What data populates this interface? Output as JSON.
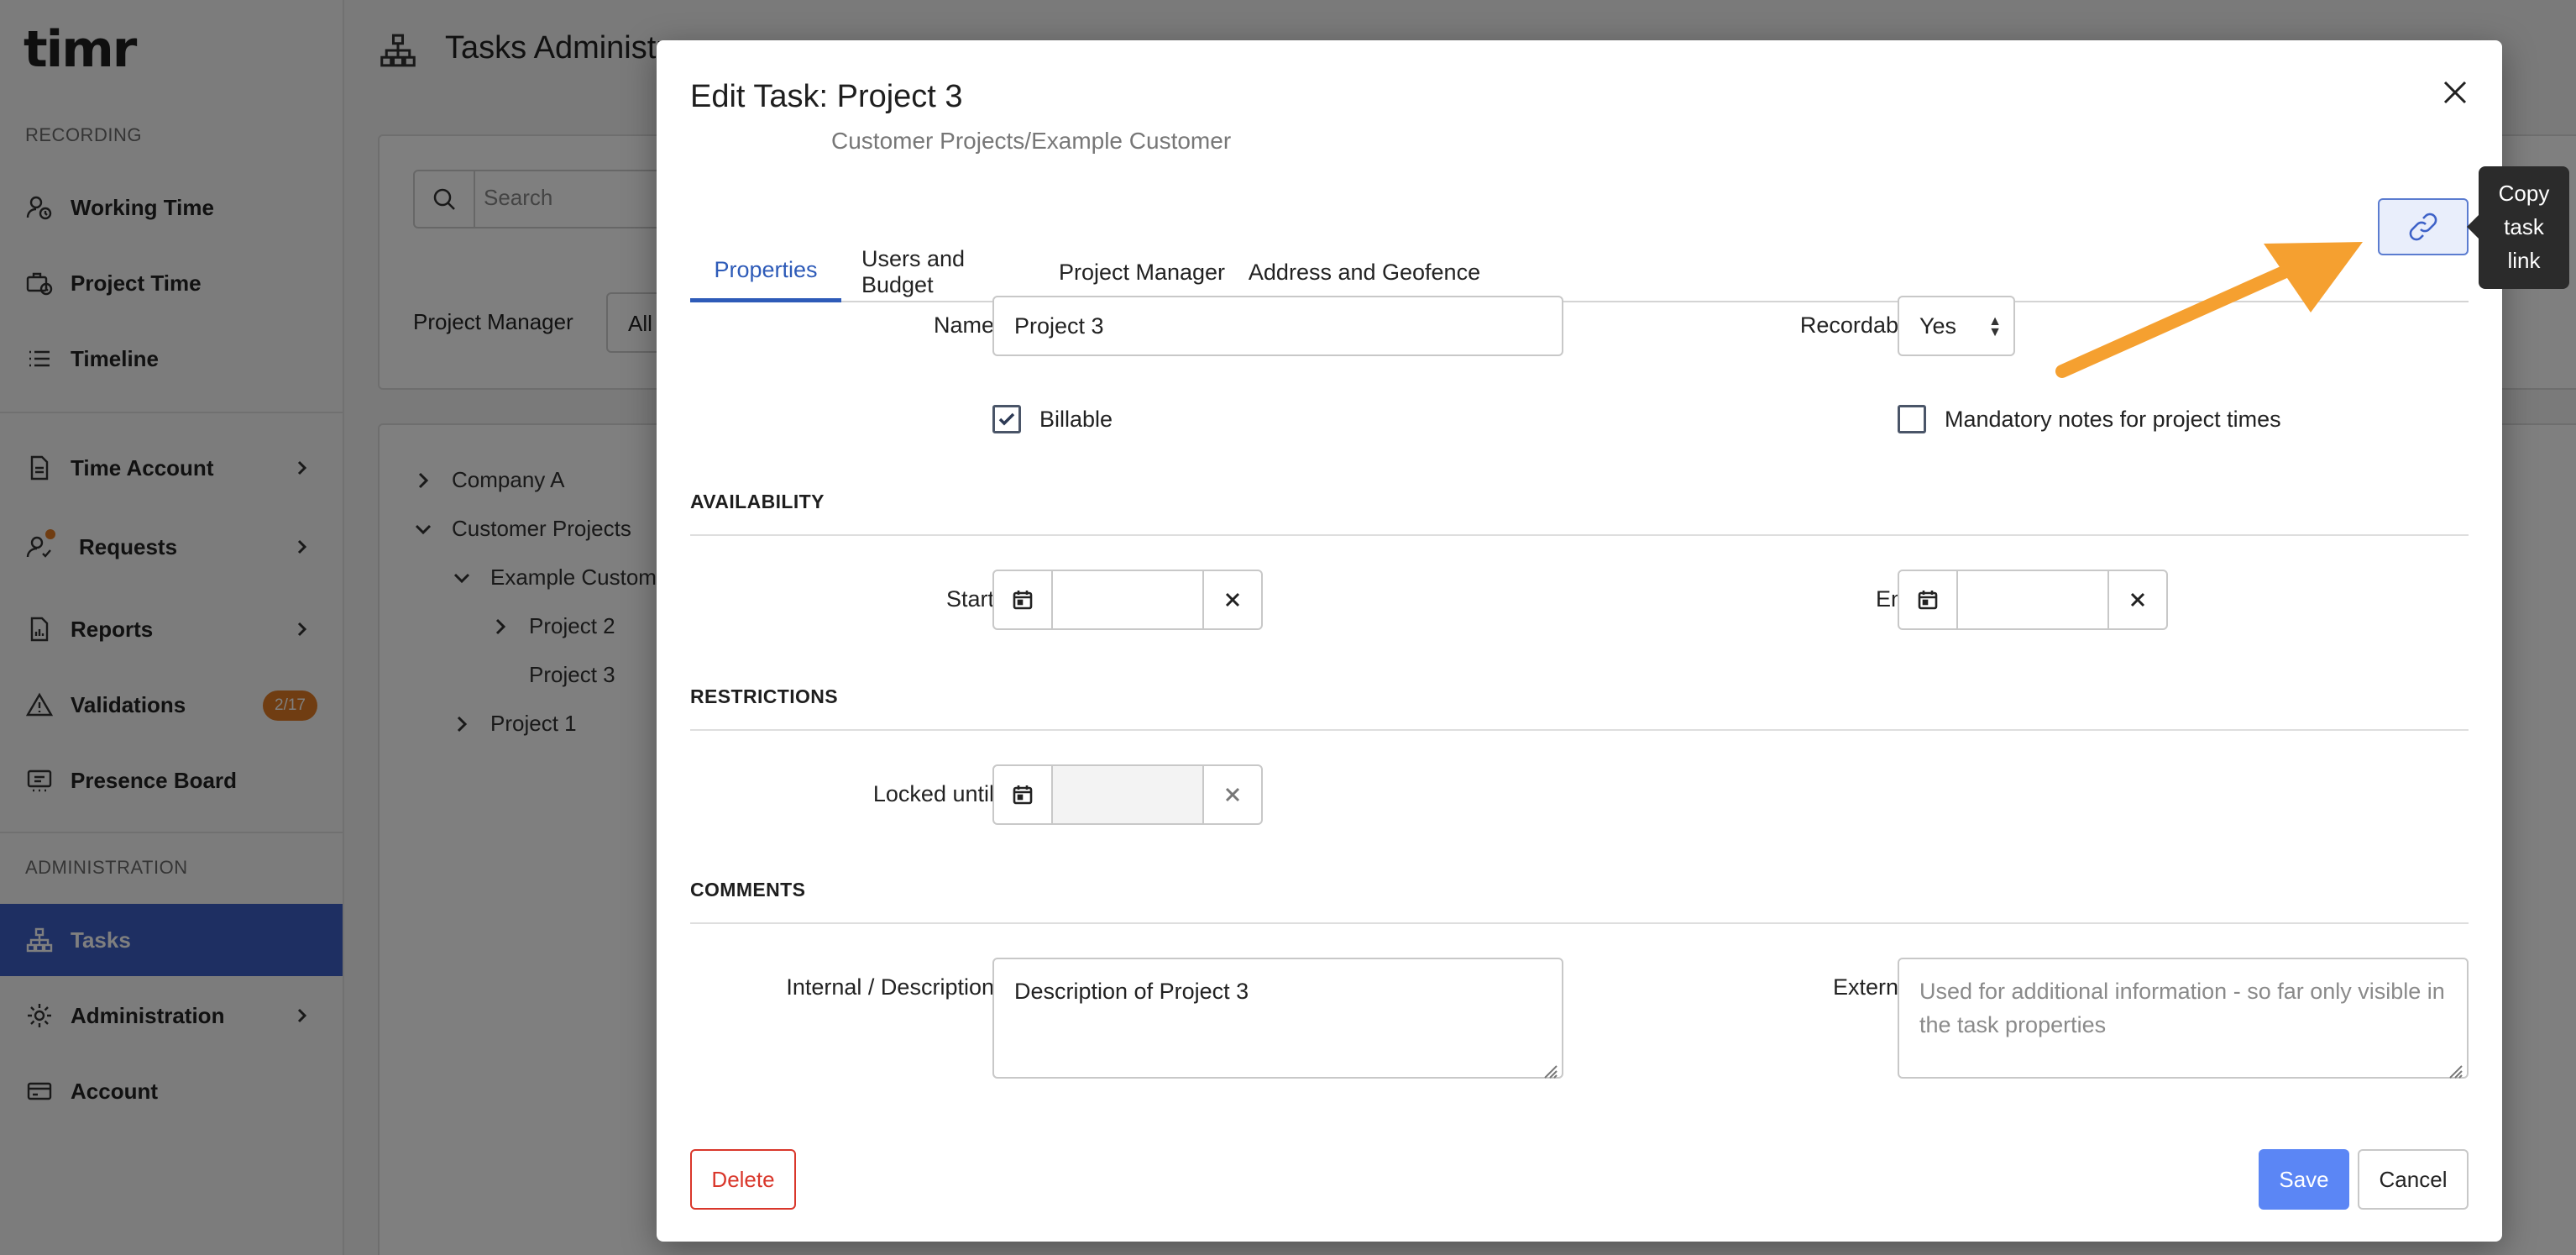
{
  "app": {
    "logo": "timr"
  },
  "sidebar": {
    "section_recording": "RECORDING",
    "section_administration": "ADMINISTRATION",
    "items": [
      {
        "label": "Working Time",
        "icon": "user-clock-icon"
      },
      {
        "label": "Project Time",
        "icon": "briefcase-clock-icon"
      },
      {
        "label": "Timeline",
        "icon": "list-icon"
      },
      {
        "label": "Time Account",
        "icon": "document-icon",
        "has_submenu": true
      },
      {
        "label": "Requests",
        "icon": "user-request-icon",
        "has_submenu": true,
        "notification_dot": true
      },
      {
        "label": "Reports",
        "icon": "report-icon",
        "has_submenu": true
      },
      {
        "label": "Validations",
        "icon": "warning-icon",
        "badge": "2/17"
      },
      {
        "label": "Presence Board",
        "icon": "presence-board-icon"
      },
      {
        "label": "Tasks",
        "icon": "hierarchy-icon",
        "active": true
      },
      {
        "label": "Administration",
        "icon": "gear-icon",
        "has_submenu": true
      },
      {
        "label": "Account",
        "icon": "credit-card-icon"
      }
    ]
  },
  "main": {
    "page_title": "Tasks Administr",
    "search": {
      "placeholder": "Search",
      "value": ""
    },
    "project_manager": {
      "label": "Project Manager",
      "value": "All"
    },
    "tree": [
      {
        "label": "Company A",
        "level": 0,
        "expanded": false
      },
      {
        "label": "Customer Projects",
        "level": 0,
        "expanded": true
      },
      {
        "label": "Example Custome",
        "level": 1,
        "expanded": true
      },
      {
        "label": "Project 2",
        "level": 2,
        "expanded": false
      },
      {
        "label": "Project 3",
        "level": 2,
        "leaf": true,
        "selected": true
      },
      {
        "label": "Project 1",
        "level": 1,
        "expanded": false
      }
    ]
  },
  "modal": {
    "title": "Edit Task: Project 3",
    "subtitle": "Customer Projects/Example Customer",
    "tabs": [
      {
        "label": "Properties",
        "active": true
      },
      {
        "label": "Users and Budget"
      },
      {
        "label": "Project Manager"
      },
      {
        "label": "Address and Geofence"
      }
    ],
    "copy_link_tooltip": [
      "Copy",
      "task",
      "link"
    ],
    "fields": {
      "name_label": "Name",
      "name_value": "Project 3",
      "recordable_label": "Recordable",
      "recordable_value": "Yes",
      "billable_label": "Billable",
      "billable_checked": true,
      "mandatory_notes_label": "Mandatory notes for project times",
      "mandatory_notes_checked": false
    },
    "sections": {
      "availability": "AVAILABILITY",
      "restrictions": "RESTRICTIONS",
      "comments": "COMMENTS"
    },
    "availability": {
      "start_label": "Start",
      "start_value": "",
      "end_label": "End",
      "end_value": ""
    },
    "restrictions": {
      "locked_until_label": "Locked until",
      "locked_until_value": ""
    },
    "comments": {
      "internal_label": "Internal / Description",
      "internal_value": "Description of Project 3",
      "external_label": "External",
      "external_placeholder": "Used for additional information - so far only visible in the task properties"
    },
    "buttons": {
      "delete": "Delete",
      "save": "Save",
      "cancel": "Cancel"
    }
  },
  "colors": {
    "accent": "#2e5bb8",
    "sidebar_active": "#3d5fc4",
    "save_button": "#5b86f5",
    "delete": "#d9372b",
    "annotation_arrow": "#f5a030",
    "badge": "#e07b24"
  }
}
